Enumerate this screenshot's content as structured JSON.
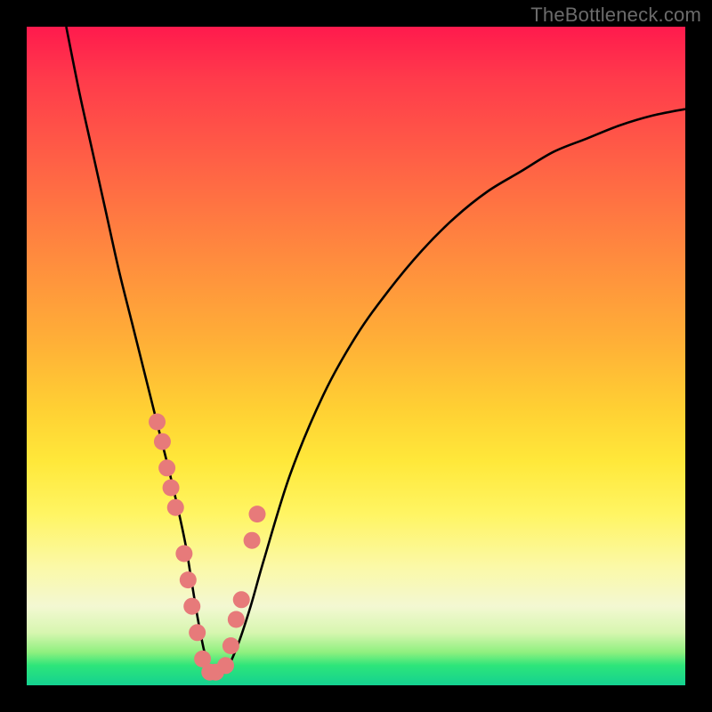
{
  "watermark": "TheBottleneck.com",
  "colors": {
    "frame": "#000000",
    "curve": "#000000",
    "dot": "#e77a7a"
  },
  "chart_data": {
    "type": "line",
    "title": "",
    "xlabel": "",
    "ylabel": "",
    "xlim": [
      0,
      100
    ],
    "ylim": [
      0,
      100
    ],
    "series": [
      {
        "name": "bottleneck-curve",
        "x": [
          6,
          8,
          10,
          12,
          14,
          16,
          18,
          20,
          22,
          24,
          25,
          26,
          27,
          28,
          30,
          32,
          34,
          36,
          40,
          45,
          50,
          55,
          60,
          65,
          70,
          75,
          80,
          85,
          90,
          95,
          100
        ],
        "y": [
          100,
          90,
          81,
          72,
          63,
          55,
          47,
          39,
          31,
          22,
          16,
          10,
          5,
          2,
          2,
          6,
          12,
          19,
          32,
          44,
          53,
          60,
          66,
          71,
          75,
          78,
          81,
          83,
          85,
          86.5,
          87.5
        ]
      }
    ],
    "scatter_points": {
      "name": "sample-dots",
      "x": [
        19.8,
        20.6,
        21.3,
        21.9,
        22.6,
        23.9,
        24.5,
        25.1,
        25.9,
        26.7,
        27.8,
        28.7,
        30.2,
        31.0,
        31.8,
        32.6,
        34.2,
        35.0
      ],
      "y": [
        40,
        37,
        33,
        30,
        27,
        20,
        16,
        12,
        8,
        4,
        2,
        2,
        3,
        6,
        10,
        13,
        22,
        26
      ]
    }
  }
}
